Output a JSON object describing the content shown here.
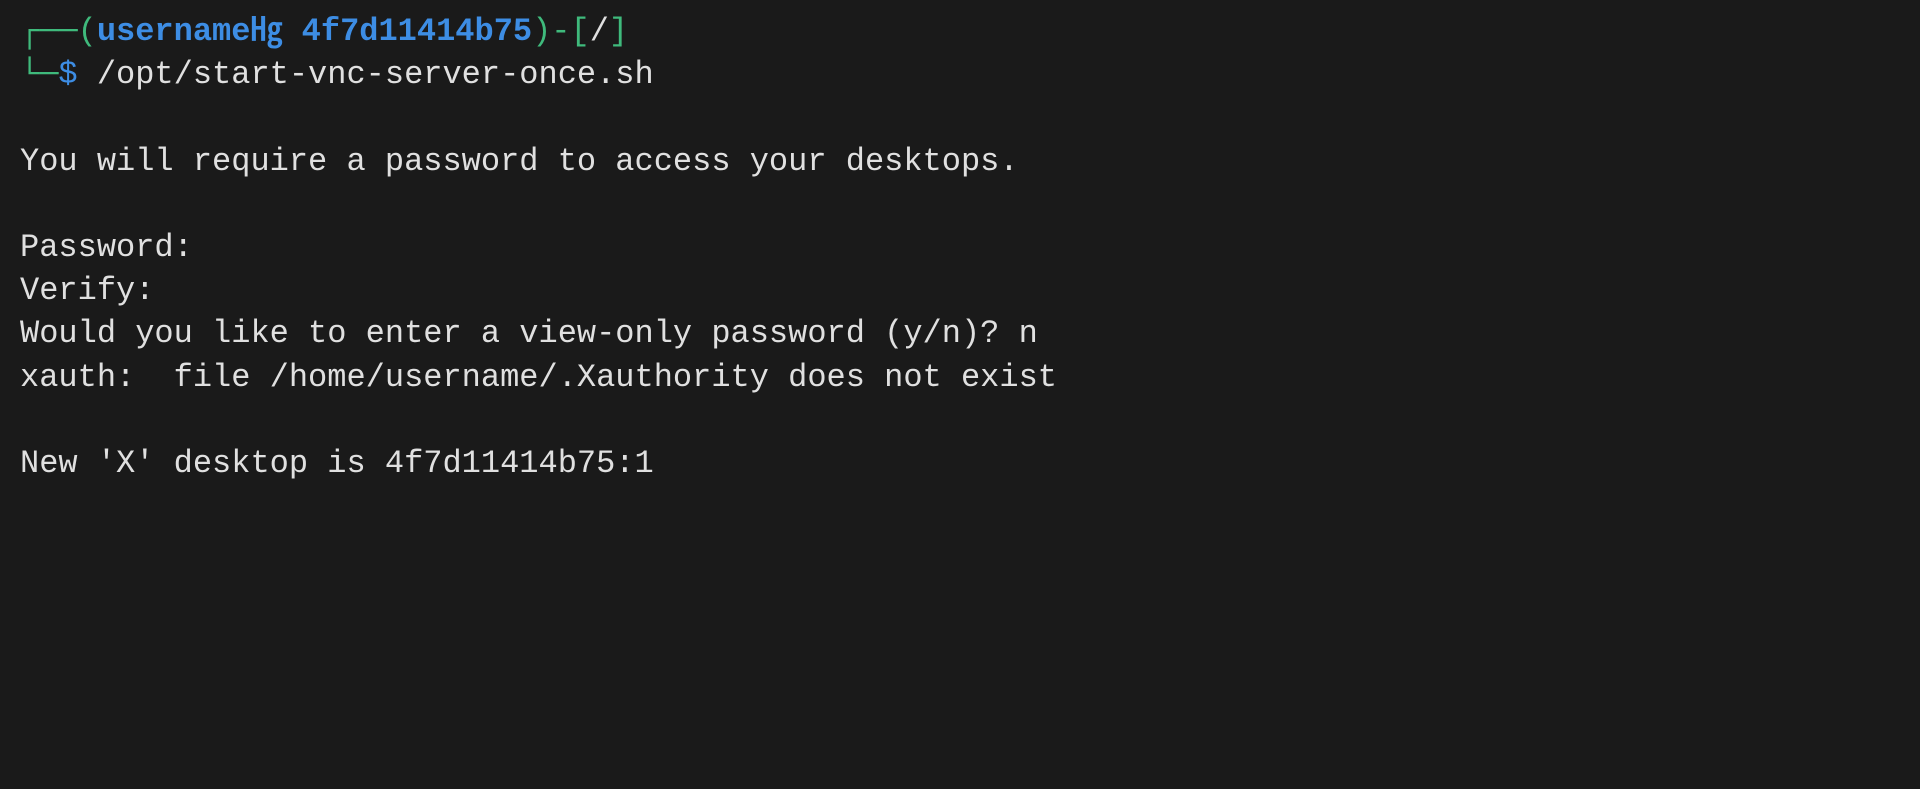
{
  "prompt": {
    "box_top_left": "┌──",
    "paren_open": "(",
    "username": "username",
    "circled_icon": "㋌",
    "separator": " ",
    "hostname": "4f7d11414b75",
    "paren_close": ")",
    "dash": "-",
    "bracket_open": "[",
    "cwd": "/",
    "bracket_close": "]",
    "box_bottom_left": "└─",
    "dollar": "$",
    "command": " /opt/start-vnc-server-once.sh"
  },
  "output": {
    "line1": "You will require a password to access your desktops.",
    "line2": "Password:",
    "line3": "Verify:",
    "line4": "Would you like to enter a view-only password (y/n)? n",
    "line5": "xauth:  file /home/username/.Xauthority does not exist",
    "line6": "New 'X' desktop is 4f7d11414b75:1"
  }
}
